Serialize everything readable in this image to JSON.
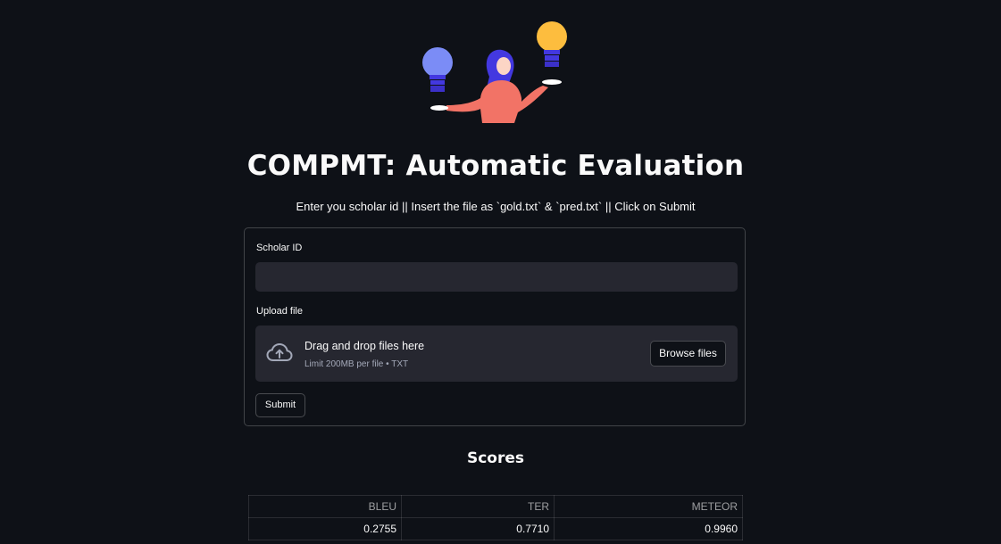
{
  "header": {
    "title": "COMPMT: Automatic Evaluation",
    "subtitle": "Enter you scholar id || Insert the file as `gold.txt` & `pred.txt` || Click on Submit"
  },
  "form": {
    "scholar_id_label": "Scholar ID",
    "scholar_id_value": "",
    "upload_label": "Upload file",
    "dropzone_title": "Drag and drop files here",
    "dropzone_limit": "Limit 200MB per file • TXT",
    "browse_label": "Browse files",
    "submit_label": "Submit"
  },
  "scores": {
    "heading": "Scores",
    "columns": [
      "BLEU",
      "TER",
      "METEOR"
    ],
    "rows": [
      [
        "0.2755",
        "0.7710",
        "0.9960"
      ]
    ]
  },
  "colors": {
    "background": "#0e1117",
    "input_bg": "#262730",
    "text": "#fafafa",
    "bulb_left": "#7b8cf6",
    "bulb_right": "#fdbd3e",
    "accent_purple": "#4338e0",
    "shirt": "#f27366"
  },
  "icons": [
    "lightbulb-illustration",
    "cloud-upload-icon"
  ]
}
